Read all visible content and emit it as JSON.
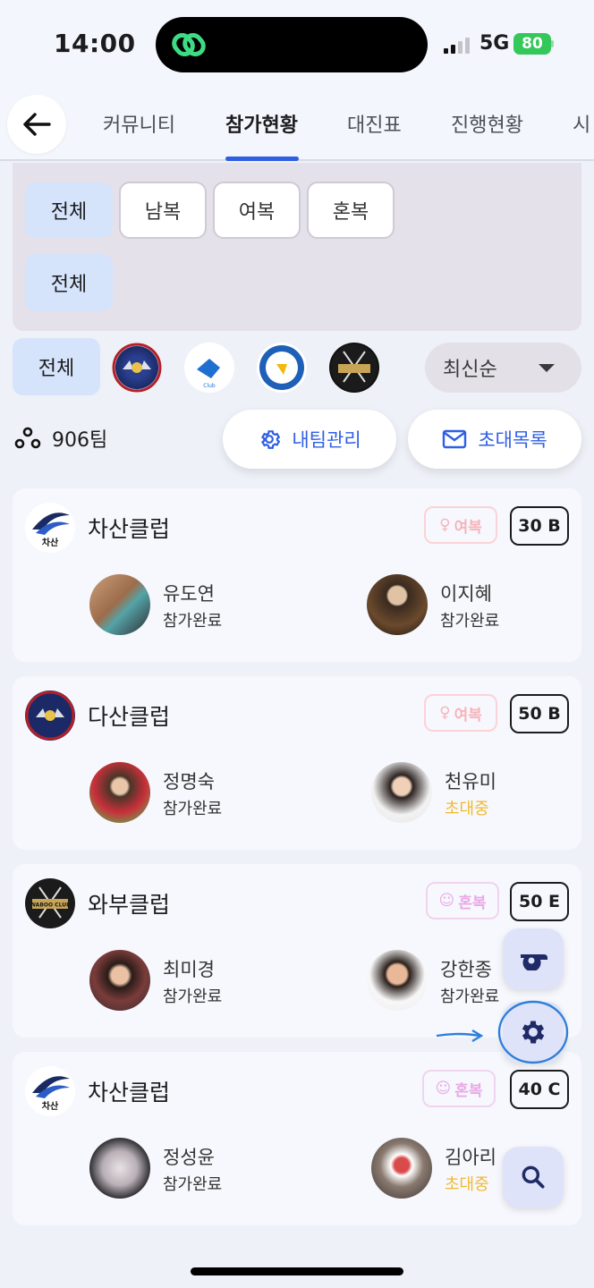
{
  "status_bar": {
    "time": "14:00",
    "network": "5G",
    "battery": "80"
  },
  "nav": {
    "tabs": [
      {
        "label": "커뮤니티"
      },
      {
        "label": "참가현황",
        "active": true
      },
      {
        "label": "대진표"
      },
      {
        "label": "진행현황"
      },
      {
        "label": "시"
      }
    ]
  },
  "filters": {
    "gender_chips": [
      "전체",
      "남복",
      "여복",
      "혼복"
    ],
    "second_row_chip": "전체",
    "club_all": "전체",
    "sort": "최신순"
  },
  "summary": {
    "team_count": "906팀",
    "manage_label": "내팀관리",
    "invite_label": "초대목록"
  },
  "teams": [
    {
      "club": "차산클럽",
      "type": "여복",
      "score": "30 B",
      "members": [
        {
          "name": "유도연",
          "status": "참가완료"
        },
        {
          "name": "이지혜",
          "status": "참가완료"
        }
      ]
    },
    {
      "club": "다산클럽",
      "type": "여복",
      "score": "50 B",
      "members": [
        {
          "name": "정명숙",
          "status": "참가완료"
        },
        {
          "name": "천유미",
          "status": "초대중"
        }
      ]
    },
    {
      "club": "와부클럽",
      "type": "혼복",
      "score": "50 E",
      "members": [
        {
          "name": "최미경",
          "status": "참가완료"
        },
        {
          "name": "강한종",
          "status": "참가완료"
        }
      ]
    },
    {
      "club": "차산클럽",
      "type": "혼복",
      "score": "40 C",
      "members": [
        {
          "name": "정성윤",
          "status": "참가완료"
        },
        {
          "name": "김아리",
          "status": "초대중"
        }
      ]
    }
  ],
  "logo_text": {
    "chasan": "차산",
    "waboo": "WABOO CLUB"
  },
  "colors": {
    "accent": "#2f5fe3",
    "invite_status": "#f1b92f",
    "chip_selected": "#d5e3fb"
  },
  "icons": [
    "back-arrow-icon",
    "people-icon",
    "gear-icon",
    "mail-icon",
    "whistle-icon",
    "search-icon"
  ]
}
